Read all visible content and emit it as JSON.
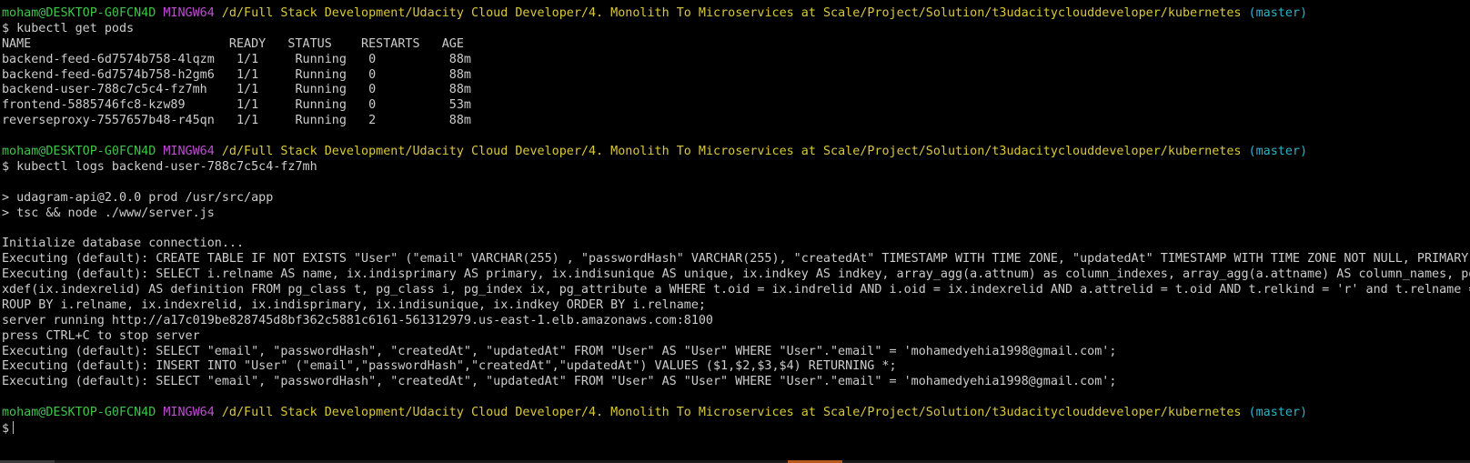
{
  "prompt": {
    "user": "moham@DESKTOP-G0FCN4D",
    "shell": "MINGW64",
    "path": "/d/Full Stack Development/Udacity Cloud Developer/4. Monolith To Microservices at Scale/Project/Solution/t3udacityclouddeveloper/kubernetes",
    "branch": "(master)",
    "symbol": "$"
  },
  "commands": {
    "get_pods": "kubectl get pods",
    "logs": "kubectl logs backend-user-788c7c5c4-fz7mh"
  },
  "pods_output": [
    "NAME                           READY   STATUS    RESTARTS   AGE",
    "backend-feed-6d7574b758-4lqzm   1/1     Running   0          88m",
    "backend-feed-6d7574b758-h2gm6   1/1     Running   0          88m",
    "backend-user-788c7c5c4-fz7mh    1/1     Running   0          88m",
    "frontend-5885746fc8-kzw89       1/1     Running   0          53m",
    "reverseproxy-7557657b48-r45qn   1/1     Running   2          88m"
  ],
  "npm_output": [
    "> udagram-api@2.0.0 prod /usr/src/app",
    "> tsc && node ./www/server.js"
  ],
  "log_output": [
    "Initialize database connection...",
    "Executing (default): CREATE TABLE IF NOT EXISTS \"User\" (\"email\" VARCHAR(255) , \"passwordHash\" VARCHAR(255), \"createdAt\" TIMESTAMP WITH TIME ZONE, \"updatedAt\" TIMESTAMP WITH TIME ZONE NOT NULL, PRIMARY KEY (\"email\"));",
    "Executing (default): SELECT i.relname AS name, ix.indisprimary AS primary, ix.indisunique AS unique, ix.indkey AS indkey, array_agg(a.attnum) as column_indexes, array_agg(a.attname) AS column_names, pg_get_in",
    "xdef(ix.indexrelid) AS definition FROM pg_class t, pg_class i, pg_index ix, pg_attribute a WHERE t.oid = ix.indrelid AND i.oid = ix.indexrelid AND a.attrelid = t.oid AND t.relkind = 'r' and t.relname = 'User' G",
    "ROUP BY i.relname, ix.indexrelid, ix.indisprimary, ix.indisunique, ix.indkey ORDER BY i.relname;",
    "server running http://a17c019be828745d8bf362c5881c6161-561312979.us-east-1.elb.amazonaws.com:8100",
    "press CTRL+C to stop server",
    "Executing (default): SELECT \"email\", \"passwordHash\", \"createdAt\", \"updatedAt\" FROM \"User\" AS \"User\" WHERE \"User\".\"email\" = 'mohamedyehia1998@gmail.com';",
    "Executing (default): INSERT INTO \"User\" (\"email\",\"passwordHash\",\"createdAt\",\"updatedAt\") VALUES ($1,$2,$3,$4) RETURNING *;",
    "Executing (default): SELECT \"email\", \"passwordHash\", \"createdAt\", \"updatedAt\" FROM \"User\" AS \"User\" WHERE \"User\".\"email\" = 'mohamedyehia1998@gmail.com';"
  ],
  "colors": {
    "background": "#000000",
    "text": "#cccccc",
    "user": "#3fc44a",
    "shell": "#c24bd6",
    "path": "#d9c83b",
    "branch": "#2fb2c8"
  }
}
